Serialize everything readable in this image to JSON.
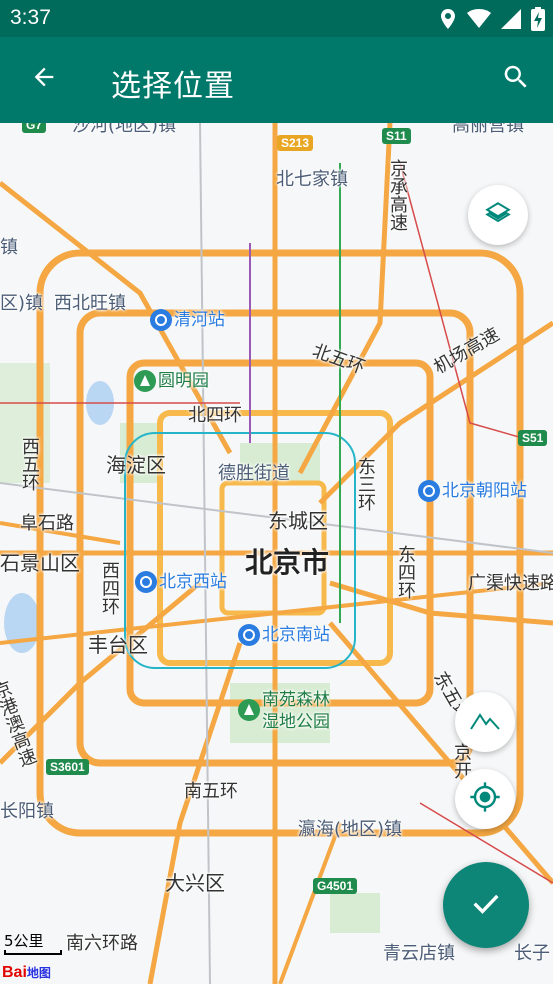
{
  "status_bar": {
    "time": "3:37",
    "icons": [
      "location-icon",
      "wifi-icon",
      "signal-icon",
      "battery-charging-icon"
    ]
  },
  "app_bar": {
    "title": "选择位置",
    "back_icon": "arrow-back-icon",
    "search_icon": "search-icon",
    "background_color": "#00796b",
    "status_color": "#006a5b"
  },
  "map": {
    "city_label": "北京市",
    "districts": [
      "海淀区",
      "东城区",
      "丰台区",
      "大兴区",
      "石景山区"
    ],
    "towns": [
      "北七家镇",
      "西北旺镇",
      "瀛海(地区)镇",
      "青云店镇",
      "长阳镇",
      "沙河(地区)镇",
      "高丽营镇",
      "区)镇",
      "镇",
      "长子"
    ],
    "roads": [
      "北五环",
      "北四环",
      "东三环",
      "东四环",
      "东五环",
      "西四环",
      "西五环",
      "南五环",
      "南六环路",
      "阜石路",
      "机场高速",
      "京承高速",
      "京港澳高速",
      "德胜街道",
      "广渠快速路",
      "京开"
    ],
    "stations": [
      "清河站",
      "北京朝阳站",
      "北京西站",
      "北京南站"
    ],
    "parks": [
      "圆明园",
      "南苑森林湿地公园"
    ],
    "shields": [
      "S11",
      "S213",
      "S51",
      "S3601",
      "G4501",
      "G7"
    ],
    "scale_label": "5公里",
    "logo_text": "Bai",
    "logo_suffix": "地图"
  },
  "controls": {
    "layers_icon": "layers-icon",
    "terrain_icon": "terrain-icon",
    "locate_icon": "my-location-icon",
    "confirm_icon": "check-icon",
    "confirm_color": "#0d8577"
  }
}
